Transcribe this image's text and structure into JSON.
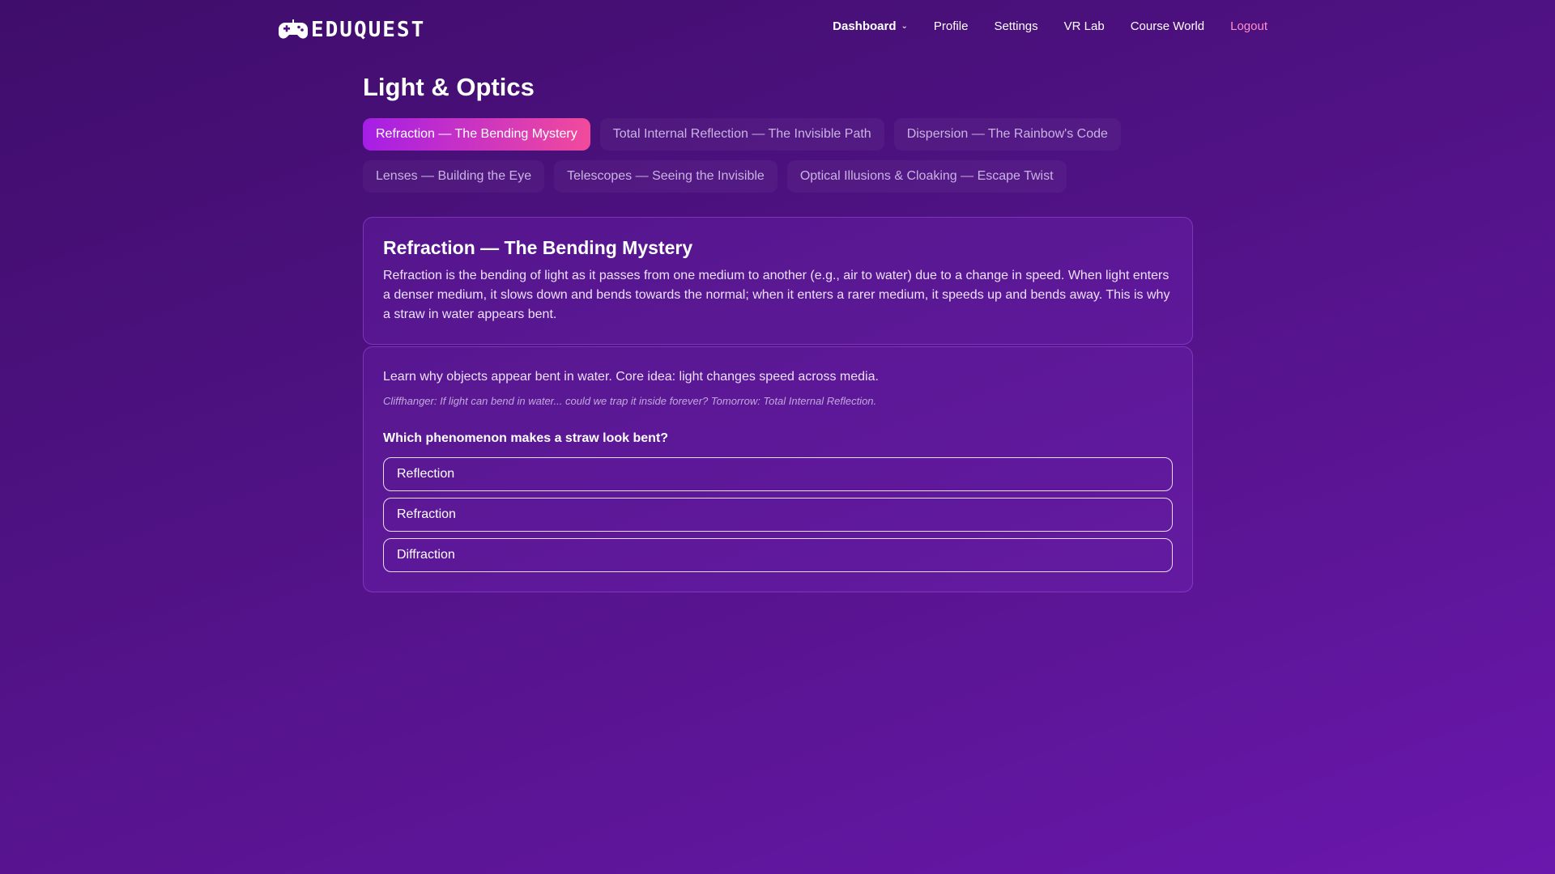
{
  "brand": {
    "name": "EDUQUEST",
    "icon": "gamepad-icon"
  },
  "nav": {
    "items": [
      {
        "label": "Dashboard"
      },
      {
        "label": "Profile"
      },
      {
        "label": "Settings"
      },
      {
        "label": "VR Lab"
      },
      {
        "label": "Course World"
      },
      {
        "label": "Logout"
      }
    ]
  },
  "page": {
    "title": "Light & Optics"
  },
  "tabs": [
    {
      "label": "Refraction — The Bending Mystery",
      "active": true
    },
    {
      "label": "Total Internal Reflection — The Invisible Path"
    },
    {
      "label": "Dispersion — The Rainbow's Code"
    },
    {
      "label": "Lenses — Building the Eye"
    },
    {
      "label": "Telescopes — Seeing the Invisible"
    },
    {
      "label": "Optical Illusions & Cloaking — Escape Twist"
    }
  ],
  "lesson": {
    "title": "Refraction — The Bending Mystery",
    "body": "Refraction is the bending of light as it passes from one medium to another (e.g., air to water) due to a change in speed. When light enters a denser medium, it slows down and bends towards the normal; when it enters a rarer medium, it speeds up and bends away. This is why a straw in water appears bent."
  },
  "quiz": {
    "intro": "Learn why objects appear bent in water. Core idea: light changes speed across media.",
    "cliffhanger": "Cliffhanger: If light can bend in water... could we trap it inside forever? Tomorrow: Total Internal Reflection.",
    "question": "Which phenomenon makes a straw look bent?",
    "options": [
      "Reflection",
      "Refraction",
      "Diffraction"
    ]
  },
  "colors": {
    "accent_start": "#a51ee6",
    "accent_end": "#f24a9c",
    "logout": "#ff8fc8",
    "background": "#4d1180"
  }
}
